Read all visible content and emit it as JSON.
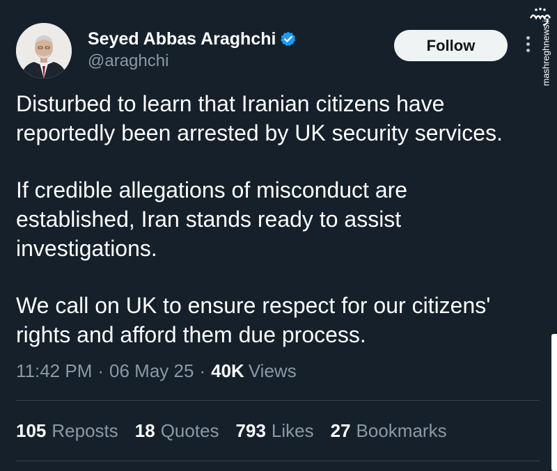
{
  "author": {
    "display_name": "Seyed Abbas Araghchi",
    "handle": "@araghchi",
    "verified": true,
    "avatar_icon": "profile-photo"
  },
  "header": {
    "follow_label": "Follow",
    "more_icon": "more-vertical-icon"
  },
  "watermark": {
    "url": "mashreghnews.ir",
    "logo": "مشرق"
  },
  "tweet": {
    "paragraphs": [
      "Disturbed to learn that Iranian citizens have\nreportedly been arrested by UK security services.",
      "If credible allegations of misconduct are\nestablished, Iran stands ready to assist\ninvestigations.",
      "We call on UK to ensure respect for our citizens'\nrights and afford them due process."
    ]
  },
  "meta": {
    "time": "11:42 PM",
    "separator": "·",
    "date": "06 May 25",
    "views_count": "40K",
    "views_label": "Views"
  },
  "stats": {
    "reposts_count": "105",
    "reposts_label": "Reposts",
    "quotes_count": "18",
    "quotes_label": "Quotes",
    "likes_count": "793",
    "likes_label": "Likes",
    "bookmarks_count": "27",
    "bookmarks_label": "Bookmarks"
  },
  "colors": {
    "background": "#15202b",
    "text_primary": "#ffffff",
    "text_secondary": "#8b98a5",
    "verified_badge": "#1d9bf0",
    "divider": "#38444d",
    "button_bg": "#eff3f4"
  }
}
